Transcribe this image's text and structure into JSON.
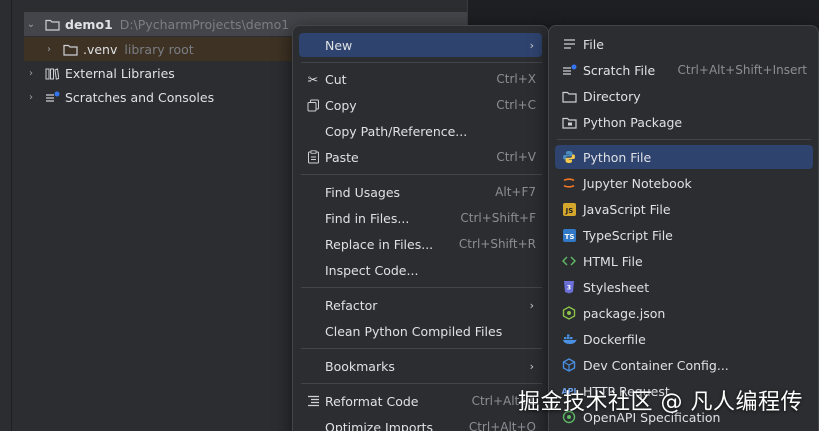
{
  "project_tree": {
    "root": {
      "name": "demo1",
      "path": "D:\\PycharmProjects\\demo1"
    },
    "venv": {
      "name": ".venv",
      "hint": "library root"
    },
    "external_libraries": "External Libraries",
    "scratches": "Scratches and Consoles"
  },
  "context_menu": {
    "new": "New",
    "cut": {
      "label": "Cut",
      "shortcut": "Ctrl+X"
    },
    "copy": {
      "label": "Copy",
      "shortcut": "Ctrl+C"
    },
    "copy_path": "Copy Path/Reference...",
    "paste": {
      "label": "Paste",
      "shortcut": "Ctrl+V"
    },
    "find_usages": {
      "label": "Find Usages",
      "shortcut": "Alt+F7"
    },
    "find_in_files": {
      "label": "Find in Files...",
      "shortcut": "Ctrl+Shift+F"
    },
    "replace_in_files": {
      "label": "Replace in Files...",
      "shortcut": "Ctrl+Shift+R"
    },
    "inspect_code": "Inspect Code...",
    "refactor": "Refactor",
    "clean_compiled": "Clean Python Compiled Files",
    "bookmarks": "Bookmarks",
    "reformat_code": {
      "label": "Reformat Code",
      "shortcut": "Ctrl+Alt+L"
    },
    "optimize_imports": {
      "label": "Optimize Imports",
      "shortcut": "Ctrl+Alt+O"
    }
  },
  "new_submenu": {
    "file": "File",
    "scratch_file": {
      "label": "Scratch File",
      "shortcut": "Ctrl+Alt+Shift+Insert"
    },
    "directory": "Directory",
    "python_package": "Python Package",
    "python_file": "Python File",
    "jupyter_notebook": "Jupyter Notebook",
    "javascript_file": "JavaScript File",
    "typescript_file": "TypeScript File",
    "html_file": "HTML File",
    "stylesheet": "Stylesheet",
    "package_json": "package.json",
    "dockerfile": "Dockerfile",
    "dev_container": "Dev Container Config...",
    "http_request": "HTTP Request",
    "openapi": "OpenAPI Specification"
  },
  "watermark": "掘金技术社区 @ 凡人编程传",
  "colors": {
    "highlight": "#2e436e",
    "menu_bg": "#2b2d30",
    "tree_bg": "#2b2d30",
    "venv_bg": "#3d3223"
  }
}
